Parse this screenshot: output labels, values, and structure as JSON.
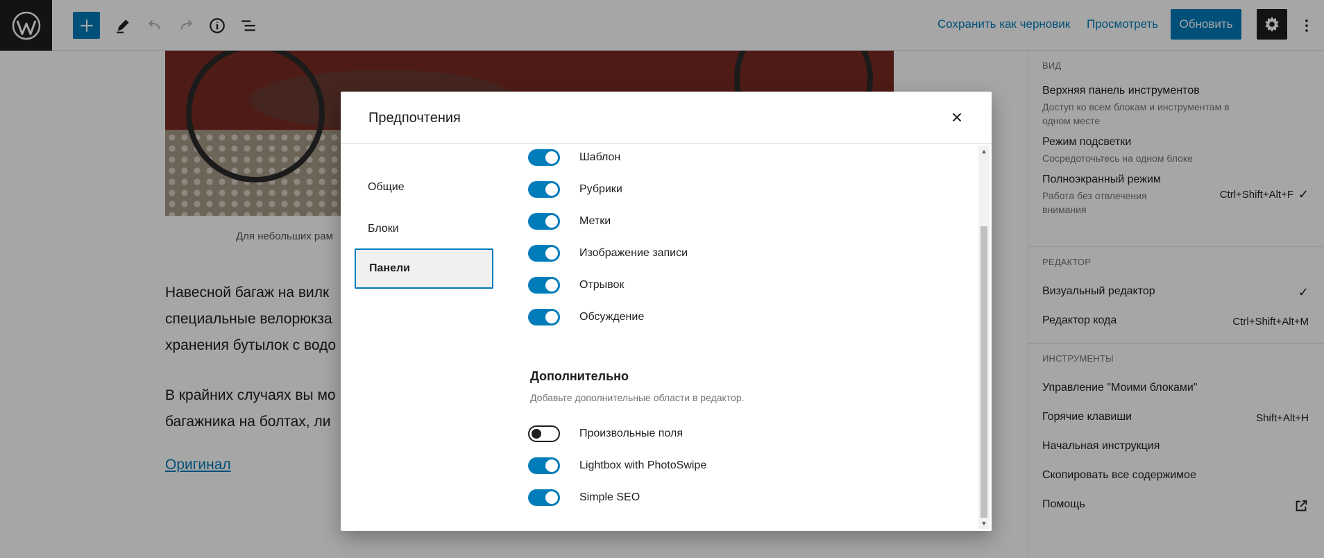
{
  "toolbar": {
    "add_icon": "plus-icon",
    "tools_icon": "pencil-icon",
    "undo_icon": "undo-icon",
    "redo_icon": "redo-icon",
    "info_icon": "info-icon",
    "list_icon": "list-view-icon",
    "save_draft": "Сохранить как черновик",
    "preview": "Просмотреть",
    "update": "Обновить",
    "settings_icon": "gear-icon",
    "more_icon": "more-vertical-icon"
  },
  "editor": {
    "caption": "Для небольших рам",
    "paragraphs": [
      "Навесной багаж на вилк",
      "специальные велорюкза",
      "хранения бутылок с водо",
      "В крайних случаях вы мо",
      "багажника на болтах, ли"
    ],
    "original_link": "Оригинал"
  },
  "sidebar": {
    "view": {
      "heading": "Вид",
      "items": [
        {
          "title": "Верхняя панель инструментов",
          "desc": "Доступ ко всем блокам и инструментам в одном месте"
        },
        {
          "title": "Режим подсветки",
          "desc": "Сосредоточьтесь на одном блоке"
        },
        {
          "title": "Полноэкранный режим",
          "desc": "Работа без отвлечения внимания",
          "shortcut": "Ctrl+Shift+Alt+F",
          "checked": "✓"
        }
      ]
    },
    "editor": {
      "heading": "Редактор",
      "items": [
        {
          "title": "Визуальный редактор",
          "checked": "✓"
        },
        {
          "title": "Редактор кода",
          "shortcut": "Ctrl+Shift+Alt+M"
        }
      ]
    },
    "tools": {
      "heading": "Инструменты",
      "items": [
        {
          "title": "Управление \"Моими блоками\""
        },
        {
          "title": "Горячие клавиши",
          "shortcut": "Shift+Alt+H"
        },
        {
          "title": "Начальная инструкция"
        },
        {
          "title": "Скопировать все содержимое"
        },
        {
          "title": "Помощь",
          "icon": "external-link-icon"
        }
      ]
    }
  },
  "modal": {
    "title": "Предпочтения",
    "close_icon": "close-icon",
    "nav": [
      "Общие",
      "Блоки",
      "Панели"
    ],
    "active_nav": "Панели",
    "panels": [
      {
        "label": "Шаблон",
        "on": true
      },
      {
        "label": "Рубрики",
        "on": true
      },
      {
        "label": "Метки",
        "on": true
      },
      {
        "label": "Изображение записи",
        "on": true
      },
      {
        "label": "Отрывок",
        "on": true
      },
      {
        "label": "Обсуждение",
        "on": true
      }
    ],
    "extra_heading": "Дополнительно",
    "extra_desc": "Добавьте дополнительные области в редактор.",
    "extra_panels": [
      {
        "label": "Произвольные поля",
        "on": false
      },
      {
        "label": "Lightbox with PhotoSwipe",
        "on": true
      },
      {
        "label": "Simple SEO",
        "on": true
      }
    ]
  },
  "colors": {
    "accent": "#007cba",
    "dark": "#1e1e1e",
    "muted": "#757575"
  }
}
